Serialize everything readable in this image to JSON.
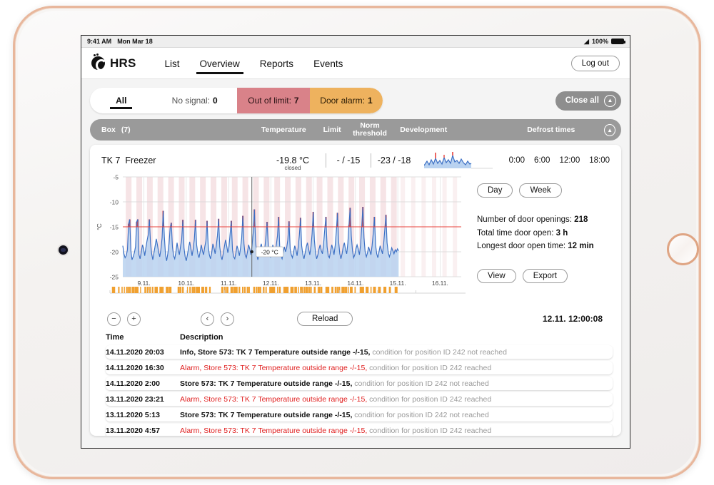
{
  "status_bar": {
    "time": "9:41 AM",
    "date": "Mon Mar 18",
    "battery": "100%",
    "wifi_icon": "wifi-icon"
  },
  "nav": {
    "brand": "HRS",
    "logo_icon": "hrs-logo-icon",
    "tabs": [
      {
        "label": "List",
        "active": false
      },
      {
        "label": "Overview",
        "active": true
      },
      {
        "label": "Reports",
        "active": false
      },
      {
        "label": "Events",
        "active": false
      }
    ],
    "logout": "Log out"
  },
  "filters": {
    "all": "All",
    "no_signal_label": "No signal:",
    "no_signal_count": "0",
    "out_of_limit_label": "Out of limit:",
    "out_of_limit_count": "7",
    "door_alarm_label": "Door alarm:",
    "door_alarm_count": "1",
    "close_all": "Close all",
    "collapse_icon": "chevron-up-icon",
    "colors": {
      "out_of_limit": "#d98289",
      "door_alarm": "#eeb25e",
      "bar": "#9a9a9a"
    }
  },
  "columns": {
    "box": "Box",
    "box_count": "(7)",
    "temperature": "Temperature",
    "limit": "Limit",
    "norm_threshold_l1": "Norm",
    "norm_threshold_l2": "threshold",
    "development": "Development",
    "defrost_times": "Defrost times",
    "collapse_icon": "chevron-up-icon"
  },
  "device": {
    "id": "TK 7",
    "name": "Freezer",
    "temperature": "-19.8 °C",
    "door_state": "closed",
    "limit": "- / -15",
    "norm_threshold": "-23 / -18",
    "sparkline_icon": "sparkline-icon"
  },
  "door_axis": [
    "0:00",
    "6:00",
    "12:00",
    "18:00"
  ],
  "range_buttons": [
    "Day",
    "Week"
  ],
  "door_stats": [
    {
      "label": "Number of door openings:",
      "value": "218"
    },
    {
      "label": "Total time door open:",
      "value": "3 h"
    },
    {
      "label": "Longest door open time:",
      "value": "12 min"
    }
  ],
  "action_buttons": [
    "View",
    "Export"
  ],
  "chart_controls": {
    "zoom_out_icon": "minus-icon",
    "zoom_out": "−",
    "zoom_in_icon": "plus-icon",
    "zoom_in": "+",
    "prev_icon": "chevron-left-icon",
    "prev": "‹",
    "next_icon": "chevron-right-icon",
    "next": "›",
    "reload": "Reload",
    "timestamp": "12.11. 12:00:08"
  },
  "chart_data": {
    "type": "line",
    "title": "",
    "xlabel": "",
    "ylabel": "°C",
    "ylim": [
      -25,
      -5
    ],
    "yticks": [
      -5,
      -10,
      -15,
      -20,
      -25
    ],
    "ytick_labels": [
      "-5",
      "-10",
      "-15",
      "-20",
      "-25"
    ],
    "xtick_labels": [
      "9.11.",
      "10.11.",
      "11.11.",
      "12.11.",
      "13.11.",
      "14.11.",
      "15.11.",
      "16.11."
    ],
    "grid": true,
    "legend": "none",
    "threshold_line": {
      "value": -15,
      "color": "#e8413a",
      "label": "Limit -15"
    },
    "annotation": {
      "text": "-20 °C",
      "x": "12.11.",
      "y": -20
    },
    "cursor_line": {
      "x": "12.11. 12:00:08"
    },
    "series": [
      {
        "name": "Temperature",
        "color": "#3b6fc4",
        "fill": "#b9d2f0",
        "values": [
          -18.8,
          -20.4,
          -21.2,
          -20.8,
          -19.6,
          -14.4,
          -13.5,
          -19.8,
          -21.6,
          -21.0,
          -20.2,
          -19.0,
          -14.0,
          -13.5,
          -20.6,
          -21.4,
          -20.0,
          -18.6,
          -19.4,
          -20.8,
          -19.2,
          -17.8,
          -16.6,
          -13.5,
          -18.2,
          -20.4,
          -21.6,
          -20.2,
          -18.8,
          -17.4,
          -18.6,
          -20.0,
          -21.0,
          -19.6,
          -17.2,
          -11.8,
          -17.0,
          -20.6,
          -21.8,
          -20.4,
          -18.4,
          -15.2,
          -14.2,
          -19.0,
          -20.8,
          -21.4,
          -20.0,
          -18.2,
          -19.6,
          -20.6,
          -19.0,
          -17.6,
          -13.6,
          -19.2,
          -21.0,
          -21.8,
          -20.6,
          -19.2,
          -18.0,
          -19.4,
          -20.8,
          -19.4,
          -17.4,
          -13.6,
          -18.6,
          -20.4,
          -21.2,
          -20.0,
          -18.6,
          -19.8,
          -20.6,
          -19.0,
          -17.8,
          -13.8,
          -18.8,
          -20.6,
          -21.4,
          -20.2,
          -18.4,
          -19.2,
          -20.4,
          -18.8,
          -16.8,
          -13.4,
          -19.0,
          -20.8,
          -21.6,
          -20.4,
          -19.0,
          -17.6,
          -18.8,
          -20.2,
          -19.0,
          -16.4,
          -13.8,
          -19.6,
          -21.0,
          -21.4,
          -20.2,
          -18.8,
          -19.6,
          -20.8,
          -19.2,
          -17.2,
          -12.8,
          -18.4,
          -20.6,
          -21.2,
          -20.0,
          -18.6,
          -19.4,
          -20.6,
          -18.8,
          -16.2,
          -11.5,
          -17.8,
          -20.4,
          -21.6,
          -20.6,
          -19.2,
          -18.4,
          -19.8,
          -20.8,
          -19.4,
          -17.0,
          -14.0,
          -18.6,
          -20.4,
          -21.0,
          -19.8,
          -18.6,
          -19.6,
          -20.4,
          -18.6,
          -16.8,
          -13.0,
          -19.2,
          -20.8,
          -21.4,
          -20.2,
          -19.0,
          -20.0,
          -19.2,
          -17.6,
          -13.9,
          -19.4,
          -20.6,
          -21.2,
          -20.0,
          -18.8,
          -19.6,
          -20.8,
          -19.0,
          -16.6,
          -13.2,
          -18.8,
          -20.6,
          -21.4,
          -20.2,
          -19.0,
          -18.2,
          -19.4,
          -20.6,
          -19.0,
          -16.4,
          -12.0,
          -17.6,
          -20.2,
          -21.4,
          -20.6,
          -19.4,
          -18.6,
          -19.8,
          -20.4,
          -18.4,
          -15.4,
          -13.0,
          -19.0,
          -20.8,
          -21.2,
          -20.0,
          -18.6,
          -19.4,
          -20.6,
          -18.8,
          -16.0,
          -12.2,
          -18.0,
          -20.4,
          -21.4,
          -20.4,
          -19.0,
          -18.2,
          -19.6,
          -20.4,
          -18.2,
          -14.6,
          -11.2,
          -16.8,
          -19.8,
          -21.2,
          -20.6,
          -19.4,
          -18.6,
          -19.4,
          -20.6,
          -18.6,
          -15.0,
          -11.0,
          -17.2,
          -20.0,
          -21.0,
          -20.2,
          -19.0,
          -19.8,
          -20.6,
          -18.8,
          -16.2,
          -13.0,
          -18.6,
          -20.4,
          -21.2,
          -20.0,
          -18.8,
          -19.6,
          -20.4,
          -18.4,
          -15.6,
          -12.6,
          -18.2,
          -20.2,
          -21.0,
          -20.2,
          -19.2,
          -19.8,
          -20.4,
          -19.6,
          -20.0,
          -19.4,
          -19.8
        ]
      }
    ],
    "alarm_bands": {
      "color": "#f6e4e6",
      "description": "vertical pink bands marking out-of-limit periods"
    },
    "door_events_strip": {
      "color": "#f0a030",
      "description": "orange tick marks below x-axis for door openings"
    }
  },
  "log": {
    "header": {
      "time": "Time",
      "description": "Description"
    },
    "rows": [
      {
        "time": "14.11.2020 20:03",
        "main": "Info, Store  573: TK 7 Temperature outside range -/-15,",
        "tail": " condition for position ID 242 not reached",
        "alarm": false
      },
      {
        "time": "14.11.2020 16:30",
        "main": "Alarm, Store  573: TK 7 Temperature outside range -/-15,",
        "tail": " condition for position ID 242 reached",
        "alarm": true
      },
      {
        "time": "14.11.2020 2:00",
        "main": "Store  573: TK 7 Temperature outside range -/-15,",
        "tail": " condition for position ID 242 not reached",
        "alarm": false
      },
      {
        "time": "13.11.2020 23:21",
        "main": "Alarm, Store  573: TK 7 Temperature outside range -/-15,",
        "tail": " condition for position ID 242 reached",
        "alarm": true
      },
      {
        "time": "13.11.2020 5:13",
        "main": "Store  573: TK 7 Temperature outside range -/-15,",
        "tail": " condition for position ID 242 not reached",
        "alarm": false
      },
      {
        "time": "13.11.2020 4:57",
        "main": "Alarm, Store  573: TK 7 Temperature outside range -/-15,",
        "tail": " condition for position ID 242 reached",
        "alarm": true
      }
    ]
  }
}
